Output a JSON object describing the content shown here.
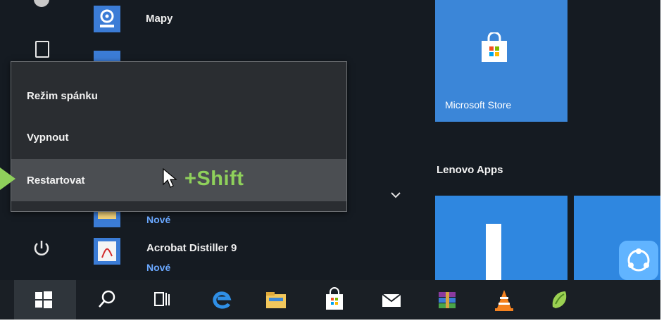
{
  "apps": {
    "mapy": {
      "label": "Mapy"
    },
    "prev_app": {
      "sub": "Nové"
    },
    "acrobat": {
      "label": "Acrobat Distiller 9",
      "sub": "Nové"
    }
  },
  "power_menu": {
    "items": [
      {
        "label": "Režim spánku"
      },
      {
        "label": "Vypnout"
      },
      {
        "label": "Restartovat",
        "highlighted": true
      }
    ]
  },
  "annotation": {
    "text": "+Shift",
    "color": "#8fd15b"
  },
  "tiles": {
    "store": {
      "label": "Microsoft Store"
    },
    "group": {
      "label": "Lenovo Apps"
    }
  },
  "taskbar": {
    "icons": [
      "windows-start-icon",
      "search-icon",
      "task-view-icon",
      "edge-icon",
      "file-explorer-icon",
      "store-icon",
      "mail-icon",
      "winrar-icon",
      "vlc-icon",
      "green-app-icon"
    ]
  },
  "colors": {
    "accent": "#3b86d8",
    "background": "#151b22"
  }
}
